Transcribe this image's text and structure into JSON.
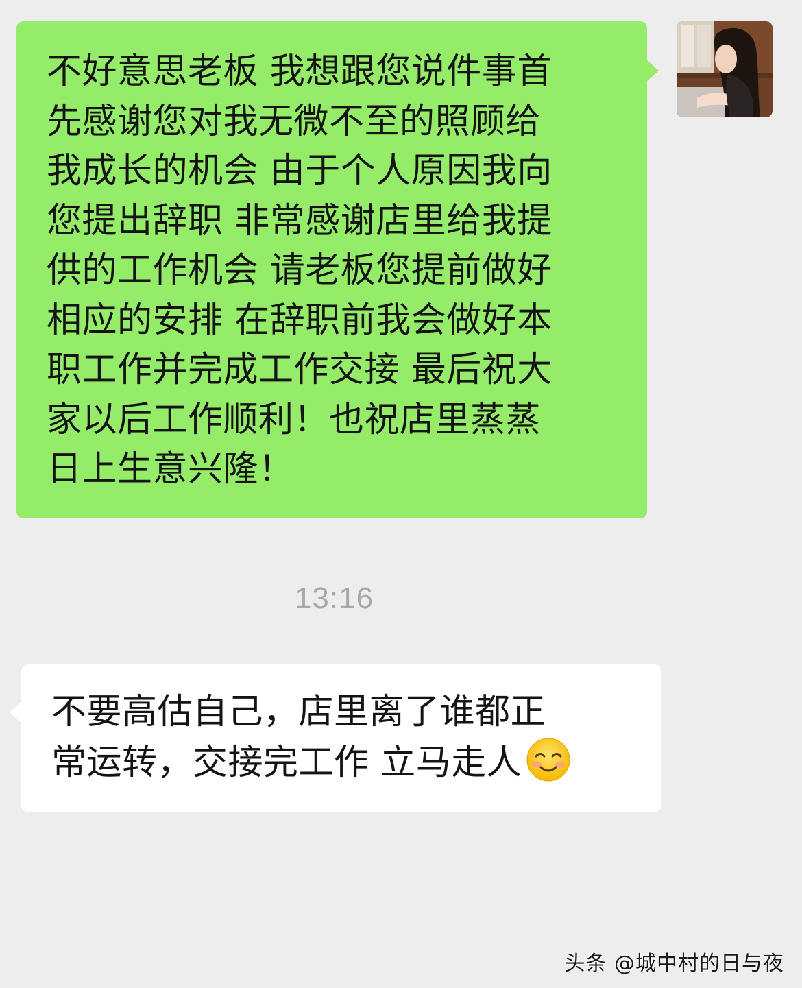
{
  "chat": {
    "sent_message": {
      "text": "不好意思老板 我想跟您说件事首先感谢您对我无微不至的照顾给我成长的机会 由于个人原因我向您提出辞职 非常感谢店里给我提供的工作机会 请老板您提前做好相应的安排 在辞职前我会做好本职工作并完成工作交接 最后祝大家以后工作顺利！也祝店里蒸蒸日上生意兴隆！",
      "lines": [
        "不好意思老板 我想跟您说件事首",
        "先感谢您对我无微不至的照顾给",
        "我成长的机会 由于个人原因我向",
        "您提出辞职 非常感谢店里给我提",
        "供的工作机会 请老板您提前做好",
        "相应的安排 在辞职前我会做好本",
        "职工作并完成工作交接 最后祝大",
        "家以后工作顺利！也祝店里蒸蒸",
        "日上生意兴隆！"
      ],
      "bubble_color": "#95ec69"
    },
    "timestamp": "13:16",
    "received_message": {
      "lines": [
        "不要高估自己，店里离了谁都正",
        "常运转，交接完工作 立马走人"
      ],
      "emoji": "smiling-face-icon",
      "bubble_color": "#ffffff"
    },
    "avatar": "avatar-photo",
    "background_color": "#ededed"
  },
  "watermark": {
    "text": "头条 @城中村的日与夜"
  }
}
